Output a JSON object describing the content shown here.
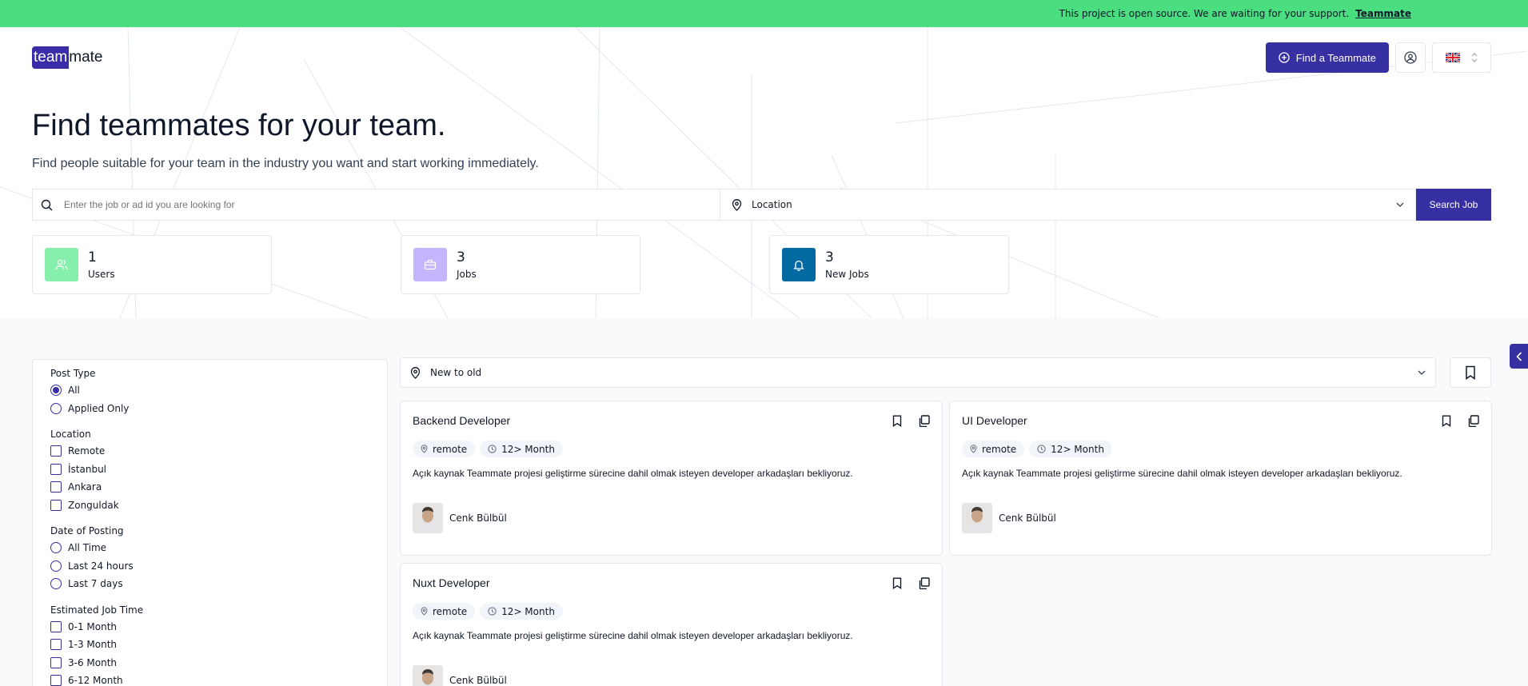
{
  "announcement": {
    "text": "This project is open source. We are waiting for your support.",
    "link": "Teammate"
  },
  "header": {
    "logo_highlight": "team",
    "logo_rest": "mate",
    "find_button": "Find a Teammate"
  },
  "hero": {
    "title": "Find teammates for your team.",
    "subtitle": "Find people suitable for your team in the industry you want and start working immediately."
  },
  "search": {
    "placeholder": "Enter the job or ad id you are looking for",
    "location_label": "Location",
    "button": "Search Job"
  },
  "stats": [
    {
      "value": "1",
      "label": "Users",
      "color": "#86efac"
    },
    {
      "value": "3",
      "label": "Jobs",
      "color": "#c4b5fd"
    },
    {
      "value": "3",
      "label": "New Jobs",
      "color": "#0369a1"
    }
  ],
  "filters": {
    "post_type": {
      "title": "Post Type",
      "options": [
        "All",
        "Applied Only"
      ],
      "selected": "All"
    },
    "location": {
      "title": "Location",
      "options": [
        "Remote",
        "İstanbul",
        "Ankara",
        "Zonguldak"
      ]
    },
    "date": {
      "title": "Date of Posting",
      "options": [
        "All Time",
        "Last 24 hours",
        "Last 7 days"
      ]
    },
    "job_time": {
      "title": "Estimated Job Time",
      "options": [
        "0-1 Month",
        "1-3 Month",
        "3-6 Month",
        "6-12 Month"
      ]
    }
  },
  "sort": {
    "selected": "New to old"
  },
  "jobs": [
    {
      "title": "Backend Developer",
      "location": "remote",
      "duration": "12> Month",
      "description": "Açık kaynak Teammate projesi geliştirme sürecine dahil olmak isteyen developer arkadaşları bekliyoruz.",
      "author": "Cenk Bülbül"
    },
    {
      "title": "UI Developer",
      "location": "remote",
      "duration": "12> Month",
      "description": "Açık kaynak Teammate projesi geliştirme sürecine dahil olmak isteyen developer arkadaşları bekliyoruz.",
      "author": "Cenk Bülbül"
    },
    {
      "title": "Nuxt Developer",
      "location": "remote",
      "duration": "12> Month",
      "description": "Açık kaynak Teammate projesi geliştirme sürecine dahil olmak isteyen developer arkadaşları bekliyoruz.",
      "author": "Cenk Bülbül"
    }
  ],
  "colors": {
    "primary": "#3730a3",
    "announcement": "#4ade80"
  }
}
